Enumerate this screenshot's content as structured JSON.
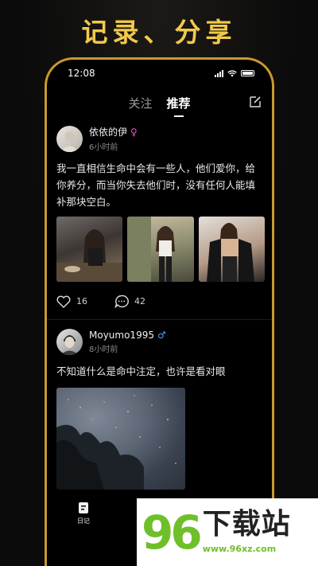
{
  "headline": "记录、分享",
  "status_bar": {
    "time": "12:08"
  },
  "nav": {
    "tabs": [
      {
        "label": "关注"
      },
      {
        "label": "推荐"
      }
    ]
  },
  "posts": [
    {
      "author": "依依的伊",
      "gender": "♀",
      "time": "6小时前",
      "text": "我一直相信生命中会有一些人，他们爱你，给你养分，而当你失去他们时，没有任何人能填补那块空白。",
      "likes": "16",
      "comments": "42"
    },
    {
      "author": "Moyumo1995",
      "gender": "♂",
      "time": "8小时前",
      "text": "不知道什么是命中注定，也许是看对眼"
    }
  ],
  "tabbar": {
    "diary_label": "日记"
  },
  "watermark": {
    "number": "96",
    "text": "下载站",
    "url": "www.96xz.com"
  },
  "colors": {
    "accent": "#f2c94c",
    "frame": "#c99a2e",
    "female": "#e05cc0",
    "male": "#4aa3ff",
    "watermark_green": "#6fbf2a"
  }
}
